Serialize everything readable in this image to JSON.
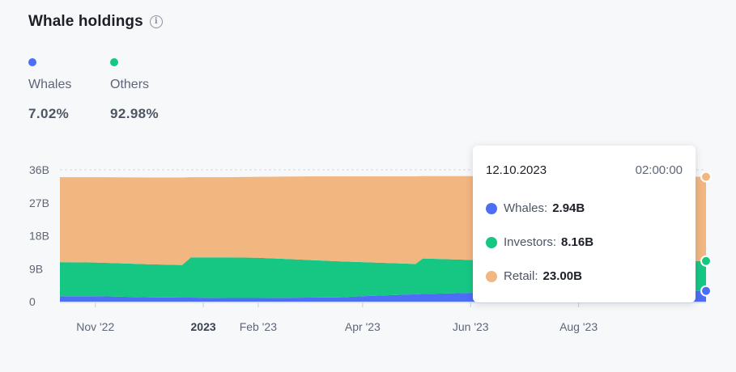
{
  "header": {
    "title": "Whale holdings",
    "info_icon": "info-icon"
  },
  "summary": [
    {
      "label": "Whales",
      "value": "7.02%",
      "color": "#4c6ef5"
    },
    {
      "label": "Others",
      "value": "92.98%",
      "color": "#16c784"
    }
  ],
  "tooltip": {
    "date": "12.10.2023",
    "time": "02:00:00",
    "rows": [
      {
        "label": "Whales:",
        "value": "2.94B",
        "color": "#4c6ef5"
      },
      {
        "label": "Investors:",
        "value": "8.16B",
        "color": "#16c784"
      },
      {
        "label": "Retail:",
        "value": "23.00B",
        "color": "#f2b680"
      }
    ]
  },
  "chart_data": {
    "type": "area",
    "stacked": true,
    "ylim": [
      0,
      36
    ],
    "yticks": [
      {
        "value": 0,
        "label": "0"
      },
      {
        "value": 9,
        "label": "9B"
      },
      {
        "value": 18,
        "label": "18B"
      },
      {
        "value": 27,
        "label": "27B"
      },
      {
        "value": 36,
        "label": "36B"
      }
    ],
    "xlim": [
      "2022-10-12",
      "2023-10-12"
    ],
    "xticks": [
      {
        "date": "2022-11-01",
        "label": "Nov '22",
        "bold": false
      },
      {
        "date": "2023-01-01",
        "label": "2023",
        "bold": true
      },
      {
        "date": "2023-02-01",
        "label": "Feb '23",
        "bold": false
      },
      {
        "date": "2023-04-01",
        "label": "Apr '23",
        "bold": false
      },
      {
        "date": "2023-06-01",
        "label": "Jun '23",
        "bold": false
      },
      {
        "date": "2023-08-01",
        "label": "Aug '23",
        "bold": false
      }
    ],
    "grid": false,
    "x": [
      "2022-10-12",
      "2022-11-01",
      "2022-12-01",
      "2022-12-20",
      "2022-12-25",
      "2023-01-15",
      "2023-02-01",
      "2023-03-01",
      "2023-03-20",
      "2023-04-01",
      "2023-05-01",
      "2023-05-05",
      "2023-06-01",
      "2023-07-01",
      "2023-08-01",
      "2023-09-01",
      "2023-10-12"
    ],
    "series": [
      {
        "name": "Whales",
        "color": "#4c6ef5",
        "values": [
          1.5,
          1.5,
          1.2,
          1.1,
          1.1,
          1.0,
          1.0,
          1.1,
          1.2,
          1.5,
          2.0,
          2.1,
          2.4,
          2.6,
          2.7,
          2.8,
          2.94
        ]
      },
      {
        "name": "Investors",
        "color": "#16c784",
        "values": [
          9.3,
          9.2,
          9.0,
          8.9,
          11.0,
          11.1,
          11.0,
          10.3,
          9.8,
          9.3,
          8.3,
          9.7,
          9.0,
          8.7,
          8.5,
          8.3,
          8.16
        ]
      },
      {
        "name": "Retail",
        "color": "#f2b680",
        "values": [
          23.2,
          23.3,
          23.7,
          23.9,
          21.9,
          21.9,
          22.1,
          22.8,
          23.2,
          23.4,
          23.9,
          22.5,
          22.9,
          23.0,
          23.1,
          23.1,
          23.0
        ]
      }
    ]
  }
}
